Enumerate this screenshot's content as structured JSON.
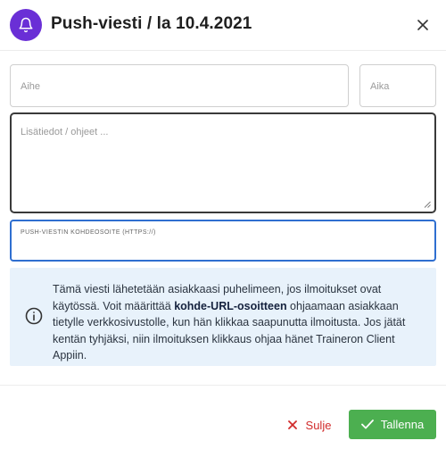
{
  "header": {
    "title": "Push-viesti / la 10.4.2021",
    "icon": "bell-icon",
    "close_icon": "close-icon",
    "accent_color": "#6a2fd6"
  },
  "form": {
    "subject_placeholder": "Aihe",
    "subject_value": "",
    "time_placeholder": "Aika",
    "time_value": "",
    "details_placeholder": "Lisätiedot / ohjeet ...",
    "details_value": "",
    "url_label": "PUSH-VIESTIN KOHDEOSOITE (HTTPS://)",
    "url_value": ""
  },
  "info": {
    "icon": "info-icon",
    "text_part1": "Tämä viesti lähetetään asiakkaasi puhelimeen, jos ilmoitukset ovat käytössä. Voit määrittää ",
    "text_bold": "kohde-URL-osoitteen",
    "text_part2": " ohjaamaan asiakkaan tietylle verkkosivustolle, kun hän klikkaa saapunutta ilmoitusta. Jos jätät kentän tyhjäksi, niin ilmoituksen klikkaus ohjaa hänet Traineron Client Appiin."
  },
  "footer": {
    "close_label": "Sulje",
    "save_label": "Tallenna",
    "close_color": "#d12b2b",
    "save_color": "#4caf50"
  }
}
